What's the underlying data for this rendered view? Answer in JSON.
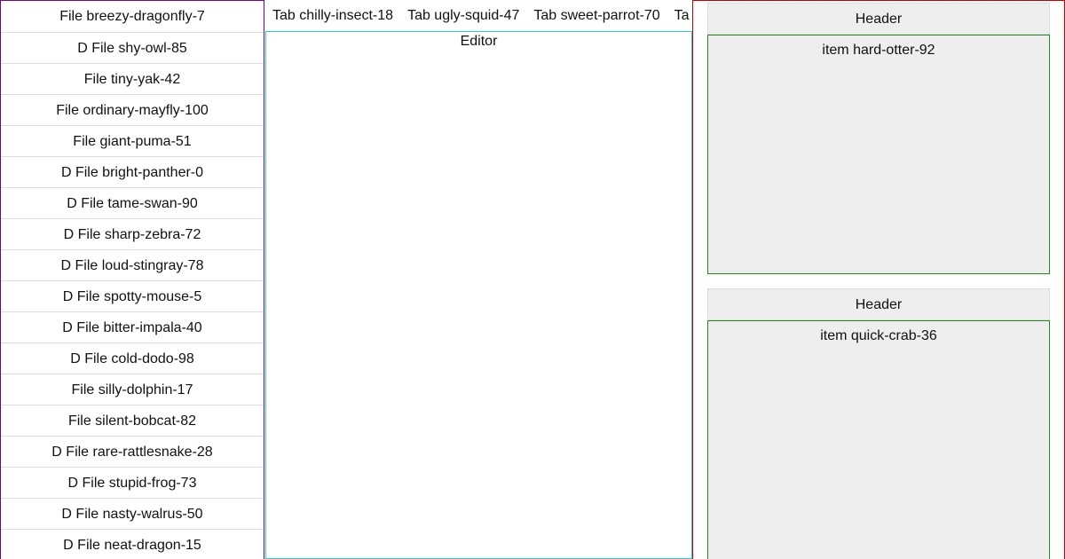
{
  "sidebar": {
    "items": [
      {
        "label": "File breezy-dragonfly-7"
      },
      {
        "label": "D File shy-owl-85"
      },
      {
        "label": "File tiny-yak-42"
      },
      {
        "label": "File ordinary-mayfly-100"
      },
      {
        "label": "File giant-puma-51"
      },
      {
        "label": "D File bright-panther-0"
      },
      {
        "label": "D File tame-swan-90"
      },
      {
        "label": "D File sharp-zebra-72"
      },
      {
        "label": "D File loud-stingray-78"
      },
      {
        "label": "D File spotty-mouse-5"
      },
      {
        "label": "D File bitter-impala-40"
      },
      {
        "label": "D File cold-dodo-98"
      },
      {
        "label": "File silly-dolphin-17"
      },
      {
        "label": "File silent-bobcat-82"
      },
      {
        "label": "D File rare-rattlesnake-28"
      },
      {
        "label": "D File stupid-frog-73"
      },
      {
        "label": "D File nasty-walrus-50"
      },
      {
        "label": "D File neat-dragon-15"
      }
    ]
  },
  "tabs": [
    {
      "label": "Tab chilly-insect-18"
    },
    {
      "label": "Tab ugly-squid-47"
    },
    {
      "label": "Tab sweet-parrot-70"
    },
    {
      "label": "Ta"
    }
  ],
  "editor": {
    "label": "Editor"
  },
  "panels": [
    {
      "header": "Header",
      "items": [
        "item hard-otter-92"
      ]
    },
    {
      "header": "Header",
      "items": [
        "item quick-crab-36"
      ]
    }
  ],
  "colors": {
    "sidebar_border": "#800080",
    "editor_border": "#33cccc",
    "right_panel_border": "#cc0000",
    "panel_body_border": "#228b22",
    "panel_background": "#eeeeee"
  }
}
